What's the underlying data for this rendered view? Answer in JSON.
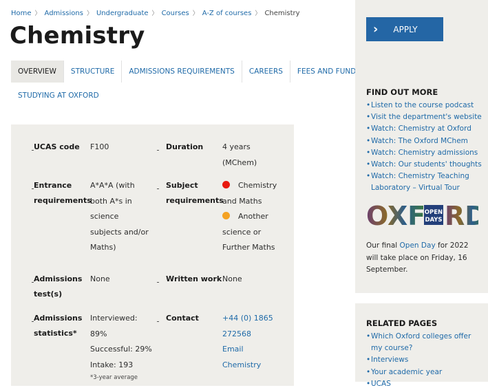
{
  "breadcrumb": {
    "items": [
      "Home",
      "Admissions",
      "Undergraduate",
      "Courses",
      "A-Z of courses"
    ],
    "current": "Chemistry",
    "separator": "〉"
  },
  "page": {
    "title": "Chemistry"
  },
  "tabs": {
    "row1": [
      "OVERVIEW",
      "STRUCTURE",
      "ADMISSIONS REQUIREMENTS",
      "CAREERS",
      "FEES AND FUNDING"
    ],
    "row2": [
      "STUDYING AT OXFORD"
    ],
    "active": "OVERVIEW"
  },
  "info": {
    "ucas_label": "UCAS code",
    "ucas_value": "F100",
    "duration_label": "Duration",
    "duration_value_1": "4 years",
    "duration_value_2": "(MChem)",
    "entrance_label_1": "Entrance",
    "entrance_label_2": "requirements",
    "entrance_value": [
      "A*A*A (with",
      "both A*s in",
      "science",
      "subjects and/or",
      "Maths)"
    ],
    "subject_label_1": "Subject",
    "subject_label_2": "requirements",
    "subject_req_1": "Chemistry",
    "subject_req_1b": "and Maths",
    "subject_req_2": "Another",
    "subject_req_2b": [
      "science or",
      "Further Maths"
    ],
    "admissions_test_label_1": "Admissions",
    "admissions_test_label_2": "test(s)",
    "admissions_test_value": "None",
    "written_label": "Written work",
    "written_value": "None",
    "stats_label_1": "Admissions",
    "stats_label_2": "statistics*",
    "stats_values": [
      "Interviewed:",
      "89%",
      "Successful: 29%",
      "Intake: 193"
    ],
    "stats_footnote": "*3-year average",
    "contact_label": "Contact",
    "contact_phone_1": "+44 (0) 1865",
    "contact_phone_2": "272568",
    "contact_email_1": "Email",
    "contact_email_2": "Chemistry"
  },
  "colors": {
    "essential_dot": "#e8190f",
    "recommended_dot": "#f4a223",
    "apply_button": "#2466a5",
    "link": "#1f6aa8"
  },
  "sidebar": {
    "apply_label": "APPLY",
    "find_out_more": {
      "heading": "FIND OUT MORE",
      "links": [
        "Listen to the course podcast",
        "Visit the department's website",
        "Watch: Chemistry at Oxford",
        "Watch: The Oxford MChem",
        "Watch: Chemistry admissions",
        "Watch: Our students' thoughts",
        "Watch: Chemistry Teaching Laboratory – Virtual Tour"
      ],
      "banner_text_left": "OXF",
      "banner_text_right": "RD",
      "banner_open": "OPEN",
      "banner_days": "DAYS",
      "open_day_pre": "Our final",
      "open_day_link": "Open Day",
      "open_day_post": "for 2022 will take place on Friday, 16 September."
    },
    "related": {
      "heading": "RELATED PAGES",
      "links": [
        "Which Oxford colleges offer my course?",
        "Interviews",
        "Your academic year",
        "UCAS"
      ]
    }
  }
}
